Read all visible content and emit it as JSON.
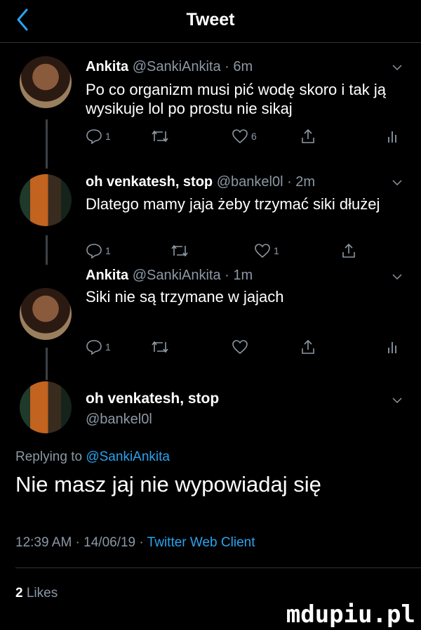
{
  "header": {
    "title": "Tweet",
    "back_icon": "chevron-left-icon"
  },
  "colors": {
    "background": "#000000",
    "link": "#2aa3ef",
    "muted": "#8b98a5",
    "text": "#ffffff"
  },
  "thread": [
    {
      "name": "Ankita",
      "handle": "@SankiAnkita · 6m",
      "text": "Po co organizm musi pić wodę skoro i tak ją wysikuje lol po prostu nie sikaj",
      "replies": "1",
      "retweets": "",
      "likes": "6"
    },
    {
      "name": "oh venkatesh, stop",
      "handle": "@bankel0l · 2m",
      "text": "Dlatego mamy jaja żeby trzymać siki dłużej",
      "replies": "1",
      "retweets": "",
      "likes": "1"
    },
    {
      "name": "Ankita",
      "handle": "@SankiAnkita · 1m",
      "text": "Siki nie są trzymane w jajach",
      "replies": "1",
      "retweets": "",
      "likes": ""
    }
  ],
  "main_tweet": {
    "name": "oh venkatesh, stop",
    "handle": "@bankel0l",
    "replying_label": "Replying to",
    "replying_to": "@SankiAnkita",
    "text": "Nie masz jaj nie wypowiadaj się",
    "timestamp": "12:39 AM · 14/06/19 ·",
    "client": "Twitter Web Client",
    "likes_count": "2",
    "likes_label": "Likes"
  },
  "watermark": "mdupiu.pl"
}
